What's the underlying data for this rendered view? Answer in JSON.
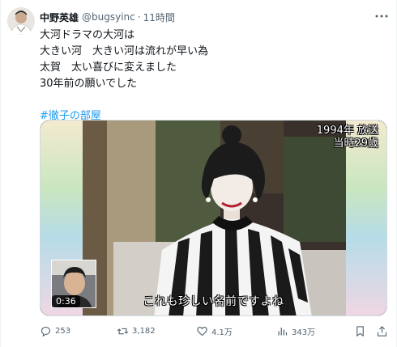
{
  "tweet": {
    "author_name": "中野英雄",
    "handle": "@bugsyinc",
    "separator": "·",
    "time": "11時間",
    "more_label": "···",
    "lines": [
      "大河ドラマの大河は",
      "大きい河　大きい河は流れが早い為",
      "太賀　太い喜びに変えました",
      "30年前の願いでした"
    ],
    "hashtag": "#徹子の部屋"
  },
  "media": {
    "caption_year": "1994年 放送",
    "caption_age": "当時29歳",
    "subtitle": "これも珍しい名前ですよね",
    "duration": "0:36"
  },
  "actions": {
    "replies": "253",
    "reposts": "3,182",
    "likes": "4.1万",
    "views": "343万"
  },
  "colors": {
    "accent": "#1d9bf0",
    "muted": "#536471",
    "text": "#0f1419"
  }
}
